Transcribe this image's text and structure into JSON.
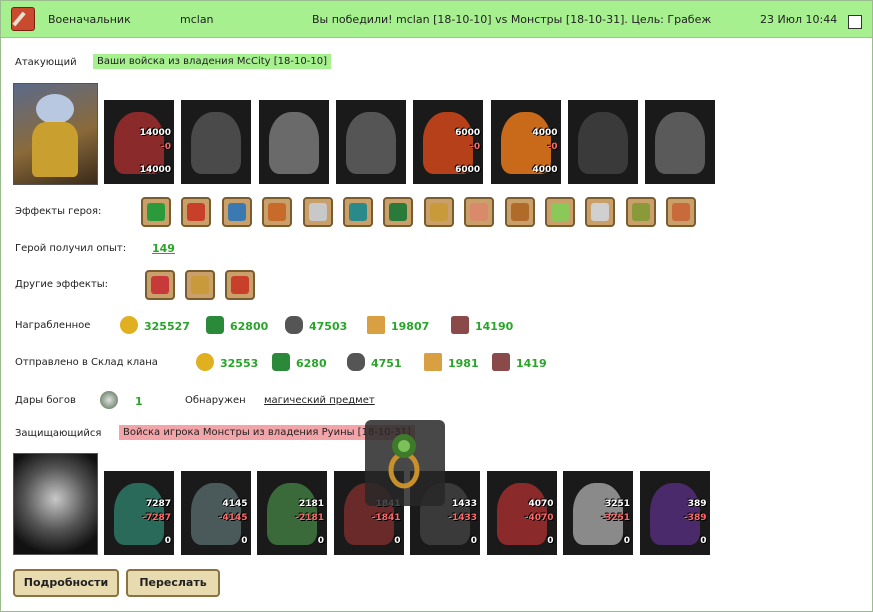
{
  "header": {
    "rank": "Военачальник",
    "player": "mclan",
    "result": "Вы победили! mclan [18-10-10] vs Монстры [18-10-31]. Цель: Грабеж",
    "time": "23 Июл 10:44"
  },
  "attacker": {
    "label": "Атакующий",
    "army": "Ваши войска из владения McCity [18-10-10]",
    "units": [
      {
        "top": "14000",
        "mid": "-0",
        "bot": "14000"
      },
      {},
      {},
      {},
      {
        "top": "6000",
        "mid": "-0",
        "bot": "6000"
      },
      {
        "top": "4000",
        "mid": "-0",
        "bot": "4000"
      },
      {},
      {}
    ]
  },
  "hero_effects_label": "Эффекты героя:",
  "hero_exp_label": "Герой получил опыт:",
  "hero_exp": "149",
  "other_effects_label": "Другие эффекты:",
  "looted": {
    "label": "Награбленное",
    "gold": "325527",
    "wood": "62800",
    "ore": "47503",
    "grain": "19807",
    "stone": "14190"
  },
  "sent": {
    "label": "Отправлено в Склад клана",
    "gold": "32553",
    "wood": "6280",
    "ore": "4751",
    "grain": "1981",
    "stone": "1419"
  },
  "gifts": {
    "label": "Дары богов",
    "value": "1",
    "found_label": "Обнаружен",
    "found_link": "магический предмет"
  },
  "defender": {
    "label": "Защищающийся",
    "army": "Войска игрока Монстры из владения Руины [18-10-31]",
    "units": [
      {
        "top": "7287",
        "mid": "-7287",
        "bot": "0"
      },
      {
        "top": "4145",
        "mid": "-4145",
        "bot": "0"
      },
      {
        "top": "2181",
        "mid": "-2181",
        "bot": "0"
      },
      {
        "top": "1841",
        "mid": "-1841",
        "bot": "0"
      },
      {
        "top": "1433",
        "mid": "-1433",
        "bot": "0"
      },
      {
        "top": "4070",
        "mid": "-4070",
        "bot": "0"
      },
      {
        "top": "3251",
        "mid": "-3251",
        "bot": "0"
      },
      {
        "top": "389",
        "mid": "-389",
        "bot": "0"
      }
    ]
  },
  "buttons": {
    "details": "Подробности",
    "forward": "Переслать"
  },
  "colors": {
    "header_bg": "#a6f08f",
    "attacker_tag": "#a6f08f",
    "defender_tag": "#f3a4a8",
    "resource_text": "#2aa52a"
  }
}
